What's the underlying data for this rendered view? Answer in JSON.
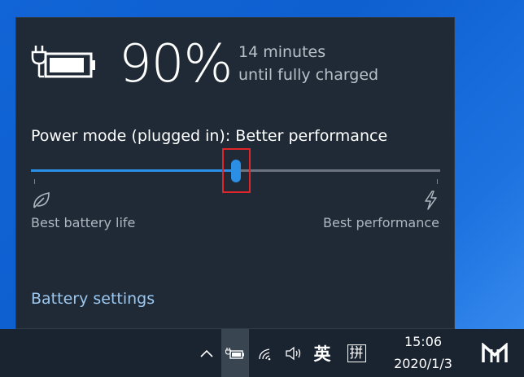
{
  "battery": {
    "percent": "90%",
    "percent_value": 90,
    "charge_line1": "14 minutes",
    "charge_line2": "until fully charged",
    "icon": "battery-charging-icon"
  },
  "power_mode": {
    "label": "Power mode (plugged in): Better performance",
    "slider_position_fraction": 0.5,
    "tick_count": 2,
    "left_label": "Best battery life",
    "right_label": "Best performance",
    "left_icon": "leaf-icon",
    "right_icon": "lightning-bolt-icon"
  },
  "links": {
    "battery_settings": "Battery settings"
  },
  "taskbar": {
    "chevron_icon": "chevron-up-icon",
    "battery_icon": "battery-charging-icon",
    "wifi_icon": "wifi-icon",
    "volume_icon": "speaker-icon",
    "ime_language": "英",
    "ime_mode": "拼",
    "time": "15:06",
    "date": "2020/1/3",
    "logo_icon": "app-logo-icon"
  },
  "colors": {
    "accent": "#2b8fe6",
    "flyout_bg": "#1f2a36",
    "link": "#9cc7ef",
    "highlight": "#e0252b"
  }
}
